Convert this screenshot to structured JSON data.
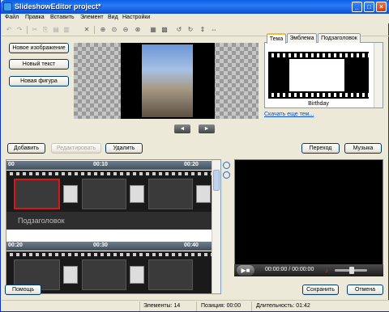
{
  "window": {
    "title": "SlideshowEditor project*"
  },
  "menu": [
    "Файл",
    "Правка",
    "Вставить",
    "Элемент",
    "Вид",
    "Настройки"
  ],
  "left_buttons": {
    "new_image": "Новое изображение",
    "new_text": "Новый текст",
    "new_shape": "Новая фигура"
  },
  "theme_panel": {
    "tabs": [
      "Тема",
      "Эмблема",
      "Подзаголовок"
    ],
    "active_tab": "Тема",
    "thumbnail_caption": "Birthday",
    "download_link": "Скачать еще тем..."
  },
  "action_buttons": {
    "add": "Добавить",
    "edit": "Редактировать",
    "delete": "Удалить",
    "transition": "Переход",
    "music": "Музыка"
  },
  "timeline": {
    "row1": {
      "ticks": [
        "00",
        "00:10",
        "00:20"
      ]
    },
    "row2": {
      "ticks": [
        "00:20",
        "00:30",
        "00:40"
      ]
    },
    "subtitle_text": "Подзаголовок"
  },
  "player": {
    "time": "00:00:00 / 00:00:00"
  },
  "bottom_buttons": {
    "help": "Помощь",
    "save": "Сохранить",
    "cancel": "Отмена"
  },
  "status": {
    "elements": "Элементы: 14",
    "position": "Позиция: 00:00",
    "duration": "Длительность: 01:42"
  },
  "colors": {
    "title_bar": "#0a5fe8",
    "selection": "#d81818",
    "link": "#0b4fd8",
    "tab_accent": "#f6b83a"
  }
}
